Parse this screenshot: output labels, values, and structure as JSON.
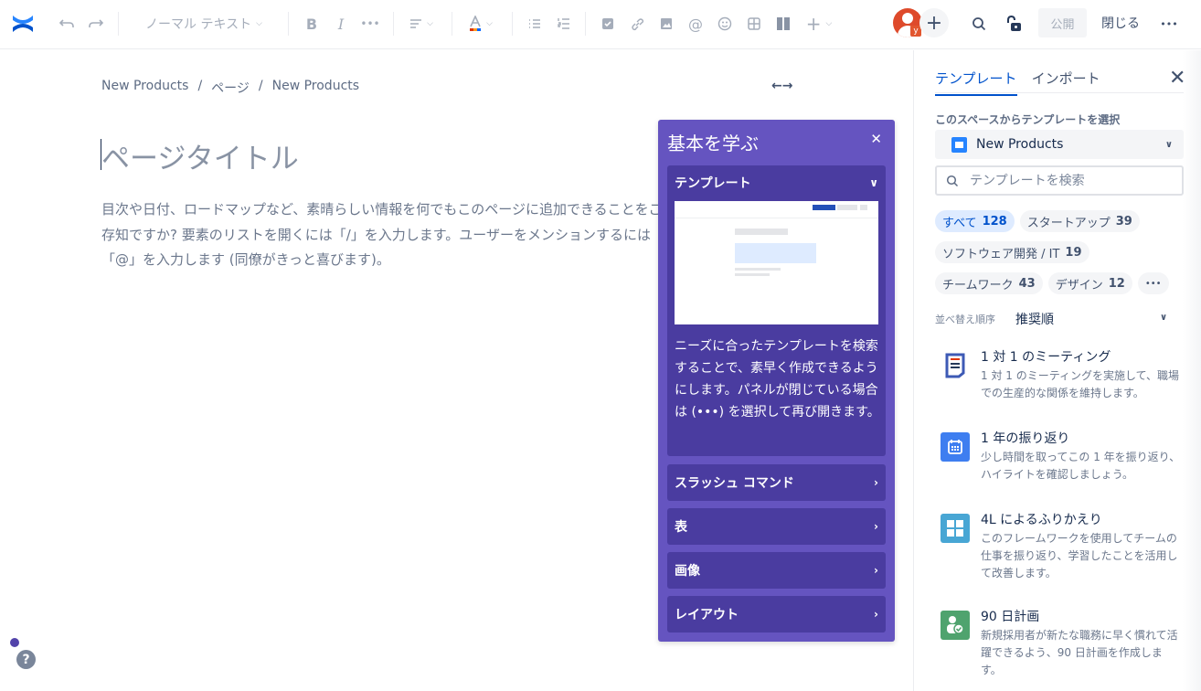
{
  "toolbar": {
    "text_style": "ノーマル テキスト",
    "publish_label": "公開",
    "close_label": "閉じる",
    "avatar_badge": "y",
    "colors": {
      "logo": "#2684ff",
      "avatar": "#de4a2b"
    }
  },
  "editor": {
    "breadcrumb": [
      "New Products",
      "/",
      "ページ",
      "/",
      "New Products"
    ],
    "title_placeholder": "ページタイトル",
    "body_placeholder": "目次や日付、ロードマップなど、素晴らしい情報を何でもこのページに追加できることをご存知ですか? 要素のリストを開くには「/」を入力します。ユーザーをメンションするには「@」を入力します (同僚がきっと喜びます)。"
  },
  "learn_panel": {
    "title": "基本を学ぶ",
    "sections": [
      {
        "label": "テンプレート",
        "expanded": true,
        "description": "ニーズに合ったテンプレートを検索することで、素早く作成できるようにします。パネルが閉じている場合は (•••) を選択して再び開きます。"
      },
      {
        "label": "スラッシュ コマンド",
        "expanded": false
      },
      {
        "label": "表",
        "expanded": false
      },
      {
        "label": "画像",
        "expanded": false
      },
      {
        "label": "レイアウト",
        "expanded": false
      }
    ],
    "colors": {
      "panel": "#6554c0",
      "section": "#4a3ca0"
    }
  },
  "sidebar": {
    "tabs": [
      {
        "label": "テンプレート",
        "active": true
      },
      {
        "label": "インポート",
        "active": false
      }
    ],
    "space_label": "このスペースからテンプレートを選択",
    "space_value": "New Products",
    "search_placeholder": "テンプレートを検索",
    "categories": [
      {
        "label": "すべて",
        "count": "128",
        "active": true
      },
      {
        "label": "スタートアップ",
        "count": "39"
      },
      {
        "label": "ソフトウェア開発 / IT",
        "count": "19"
      },
      {
        "label": "チームワーク",
        "count": "43"
      },
      {
        "label": "デザイン",
        "count": "12"
      }
    ],
    "more_label": "•••",
    "sort_label": "並べ替え順序",
    "sort_value": "推奨順",
    "templates": [
      {
        "name": "1 対 1 のミーティング",
        "description": "1 対 1 のミーティングを実施して、職場での生産的な関係を維持します。",
        "icon": "meeting-notes-icon",
        "color": "#ffffff"
      },
      {
        "name": "1 年の振り返り",
        "description": "少し時間を取ってこの 1 年を振り返り、ハイライトを確認しましょう。",
        "icon": "calendar-icon",
        "color": "#3e7ef0"
      },
      {
        "name": "4L によるふりかえり",
        "description": "このフレームワークを使用してチームの仕事を振り返り、学習したことを活用して改善します。",
        "icon": "grid-icon",
        "color": "#48a6d4"
      },
      {
        "name": "90 日計画",
        "description": "新規採用者が新たな職務に早く慣れて活躍できるよう、90 日計画を作成します。",
        "icon": "user-check-icon",
        "color": "#4fa36e"
      }
    ]
  }
}
